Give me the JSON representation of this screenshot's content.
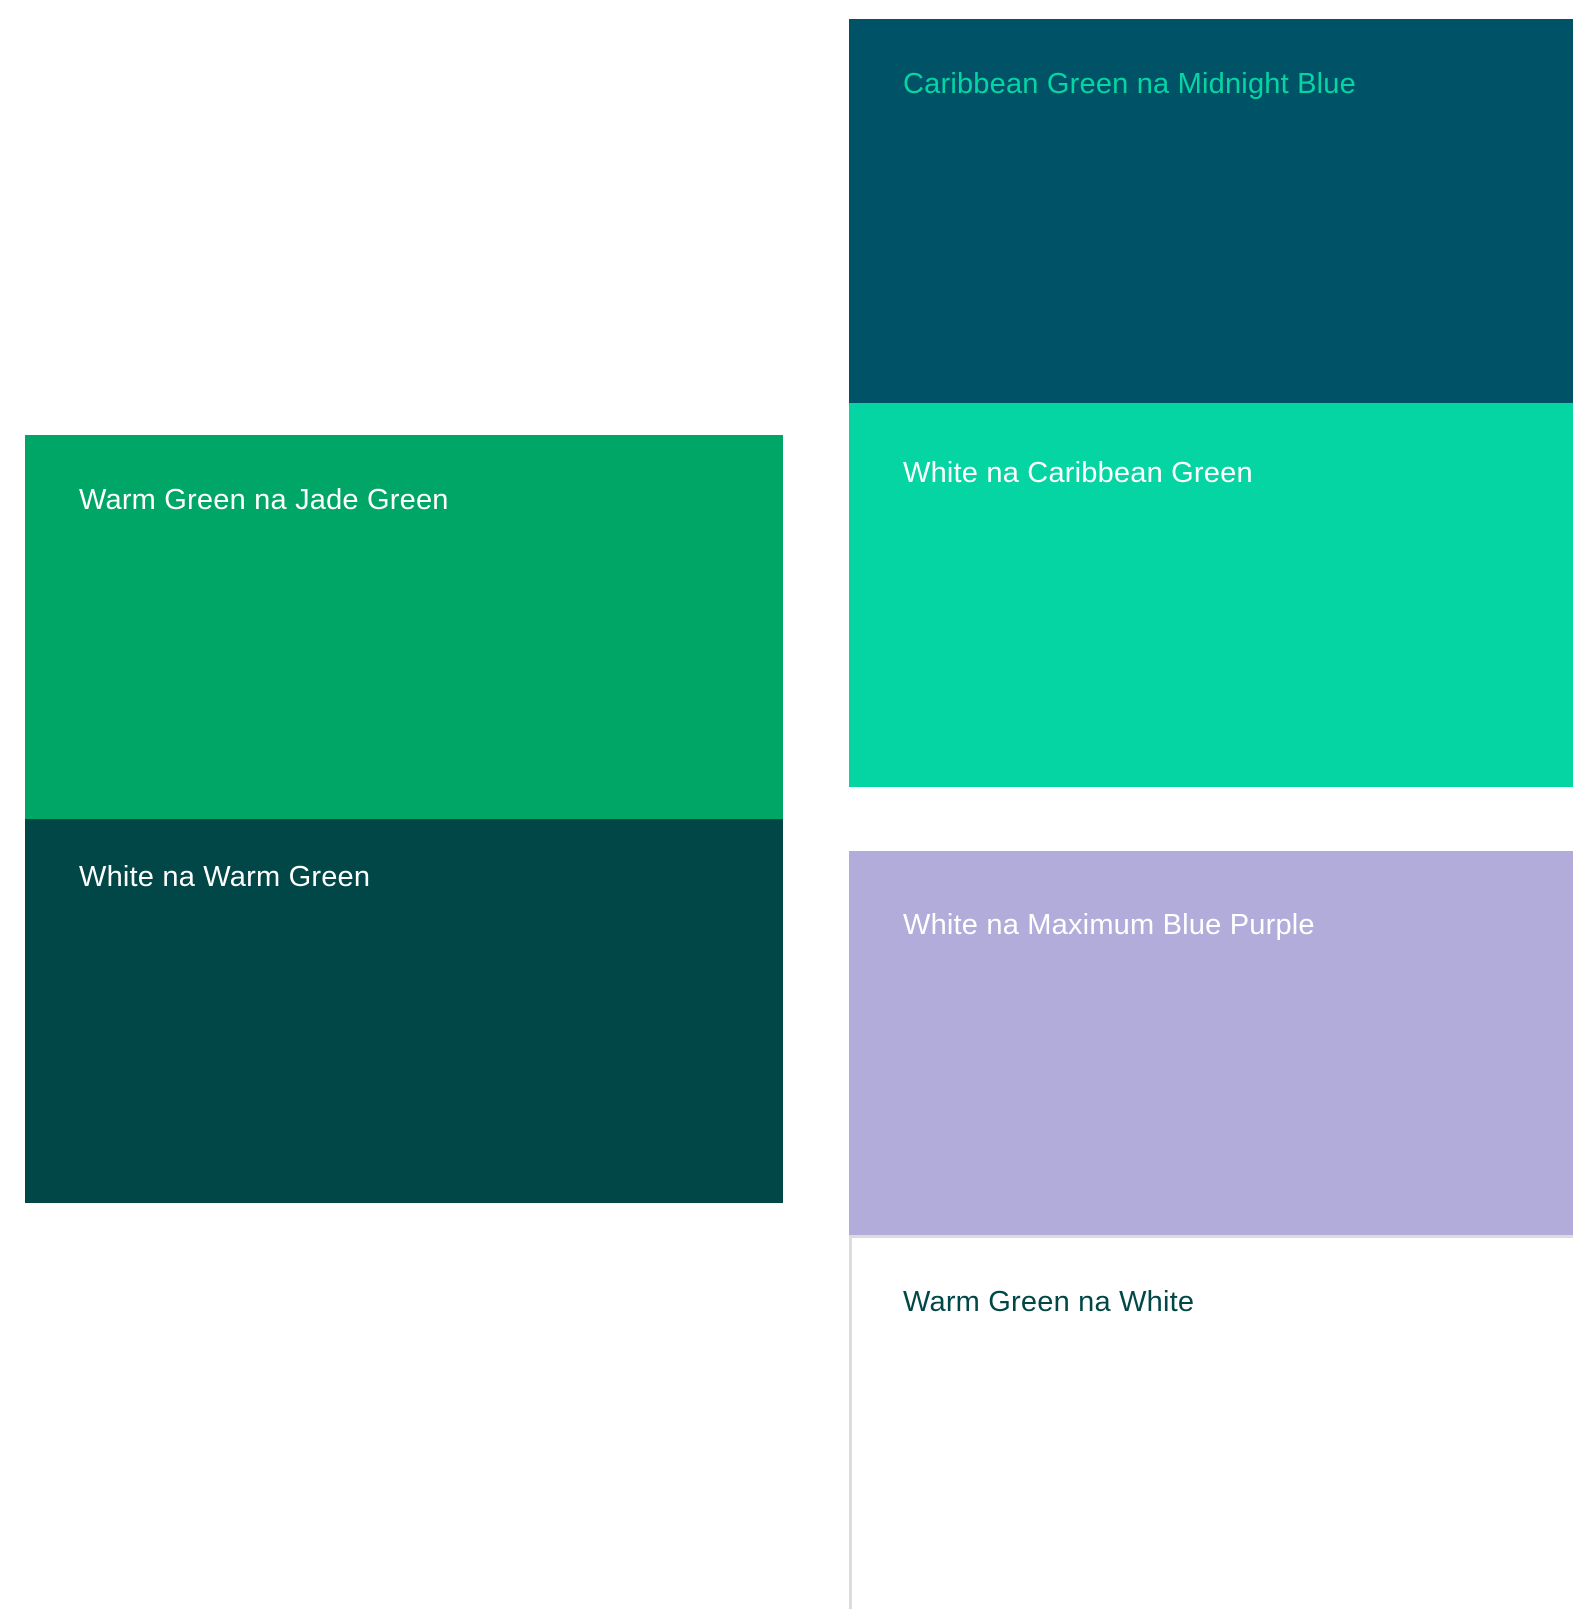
{
  "swatches": {
    "jade": {
      "label": "Warm Green na Jade Green",
      "background": "#00A666",
      "text_color": "#FFFFFF"
    },
    "warm": {
      "label": "White na Warm Green",
      "background": "#014747",
      "text_color": "#FFFFFF"
    },
    "midnight": {
      "label": "Caribbean Green na Midnight Blue",
      "background": "#005266",
      "text_color": "#05D4A3"
    },
    "caribbean": {
      "label": "White na Caribbean Green",
      "background": "#05D4A3",
      "text_color": "#FFFFFF"
    },
    "purple": {
      "label": "White na Maximum Blue Purple",
      "background": "#B2ACDB",
      "text_color": "#FFFFFF"
    },
    "white": {
      "label": "Warm Green na White",
      "background": "#FFFFFF",
      "text_color": "#014747"
    }
  }
}
